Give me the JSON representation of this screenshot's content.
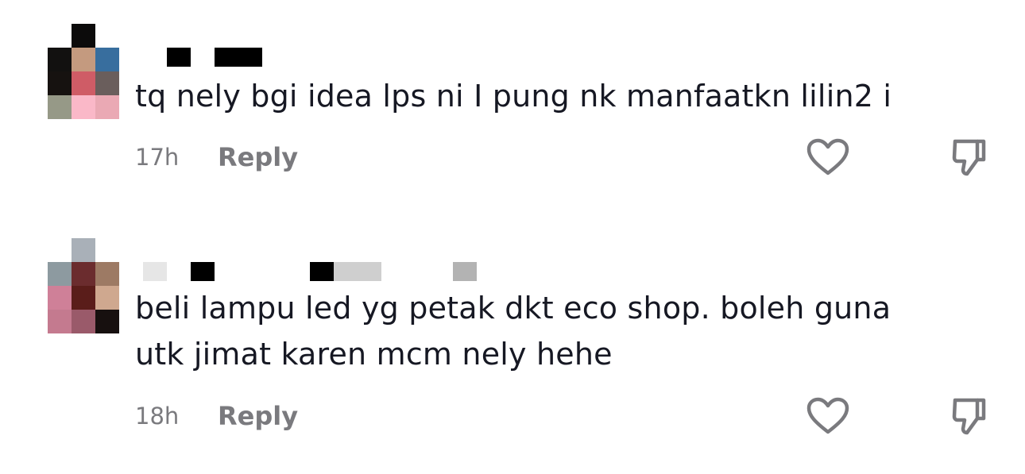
{
  "comments": [
    {
      "text_lines": [
        "tq nely bgi idea lps ni I pung nk manfaatkn lilin2 i"
      ],
      "time": "17h",
      "reply_label": "Reply",
      "like_icon": "heart-outline-icon",
      "dislike_icon": "thumbs-down-outline-icon"
    },
    {
      "text_lines": [
        "beli lampu led yg petak dkt eco shop. boleh guna",
        "utk jimat karen mcm nely hehe"
      ],
      "time": "18h",
      "reply_label": "Reply",
      "like_icon": "heart-outline-icon",
      "dislike_icon": "thumbs-down-outline-icon"
    }
  ],
  "colors": {
    "text": "#161823",
    "meta": "#7a7a7e",
    "icon": "#7a7a7e",
    "background": "#ffffff"
  }
}
